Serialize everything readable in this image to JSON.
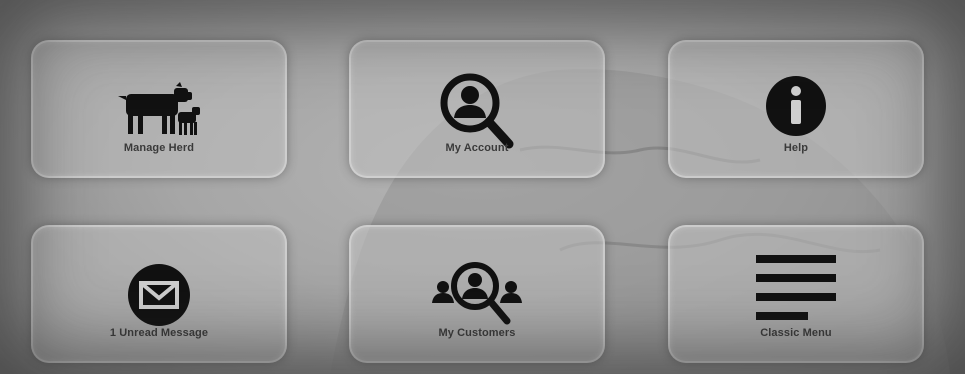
{
  "tiles": {
    "manage_herd": {
      "label": "Manage Herd",
      "icon": "cow-calf-icon"
    },
    "my_account": {
      "label": "My Account",
      "icon": "user-search-icon"
    },
    "help": {
      "label": "Help",
      "icon": "info-icon"
    },
    "unread_messages": {
      "label": "1 Unread Message",
      "icon": "envelope-icon"
    },
    "my_customers": {
      "label": "My Customers",
      "icon": "customers-search-icon"
    },
    "classic_menu": {
      "label": "Classic Menu",
      "icon": "hamburger-menu-icon"
    }
  },
  "colors": {
    "icon": "#111111",
    "label": "#3a3a3a",
    "tile_bg": "#bebebe"
  }
}
